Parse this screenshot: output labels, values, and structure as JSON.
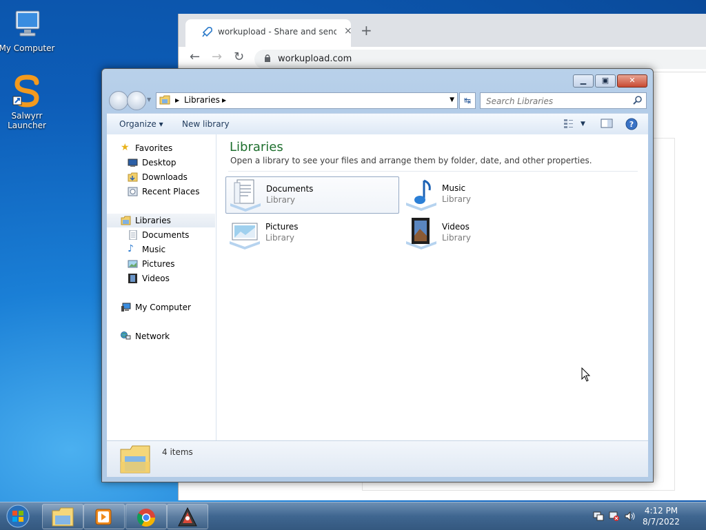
{
  "desktop": {
    "icons": [
      {
        "label": "My Computer"
      },
      {
        "label": "Salwyrr\nLauncher"
      }
    ]
  },
  "browser": {
    "tab_title": "workupload - Share and send lar",
    "tab_close": "×",
    "new_tab": "+",
    "back": "←",
    "forward": "→",
    "reload": "↻",
    "url": "workupload.com"
  },
  "explorer": {
    "address": {
      "crumb": "Libraries"
    },
    "search": {
      "placeholder": "Search Libraries"
    },
    "command_bar": {
      "organize": "Organize ▾",
      "new_library": "New library"
    },
    "nav": {
      "favorites": "Favorites",
      "desktop": "Desktop",
      "downloads": "Downloads",
      "recent": "Recent Places",
      "libraries": "Libraries",
      "documents": "Documents",
      "music": "Music",
      "pictures": "Pictures",
      "videos": "Videos",
      "computer": "My Computer",
      "network": "Network"
    },
    "content": {
      "title": "Libraries",
      "subtitle": "Open a library to see your files and arrange them by folder, date, and other properties.",
      "items": [
        {
          "name": "Documents",
          "type": "Library"
        },
        {
          "name": "Music",
          "type": "Library"
        },
        {
          "name": "Pictures",
          "type": "Library"
        },
        {
          "name": "Videos",
          "type": "Library"
        }
      ]
    },
    "details": {
      "count": "4 items"
    }
  },
  "taskbar": {
    "clock": {
      "time": "4:12 PM",
      "date": "8/7/2022"
    }
  }
}
